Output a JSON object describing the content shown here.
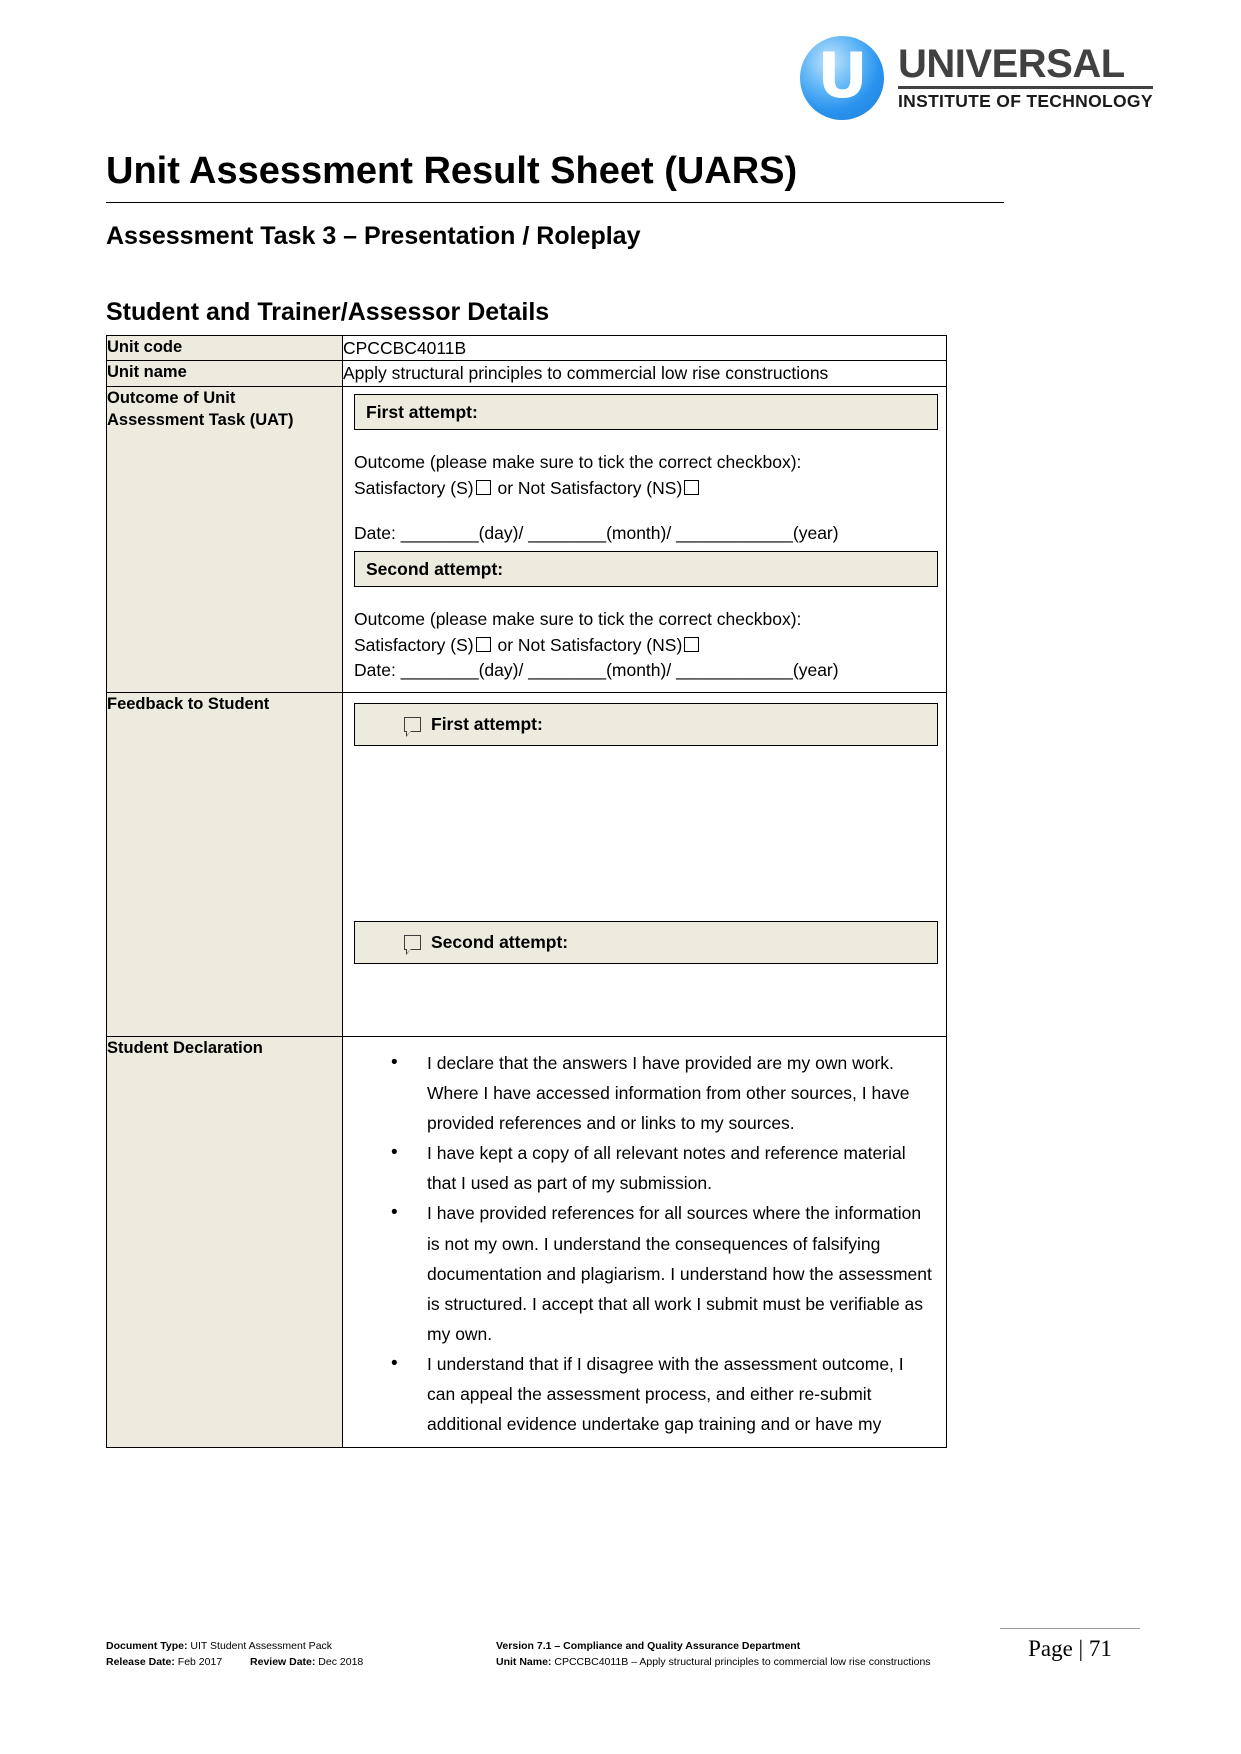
{
  "logo": {
    "mark_letter": "U",
    "title": "UNIVERSAL",
    "subtitle": "INSTITUTE OF TECHNOLOGY",
    "brand_blue": "#2a93ee"
  },
  "header": {
    "doc_title": "Unit Assessment Result Sheet (UARS)",
    "doc_subtitle": "Assessment Task 3 – Presentation / Roleplay",
    "section_title": "Student and Trainer/Assessor Details"
  },
  "table": {
    "unit_code_label": "Unit code",
    "unit_code_value": "CPCCBC4011B",
    "unit_name_label": "Unit name",
    "unit_name_value": "Apply structural principles to commercial low rise constructions",
    "outcome_label_line1": "Outcome of Unit",
    "outcome_label_line2": "Assessment Task (UAT)",
    "first_attempt": "First attempt:",
    "second_attempt": "Second attempt:",
    "outcome_instruction": "Outcome (please make sure to tick the correct checkbox):",
    "satisfactory_prefix": "Satisfactory (S)",
    "satisfactory_mid": "or Not Satisfactory (NS)",
    "date_prefix": "Date:",
    "date_day": "(day)/",
    "date_month": "(month)/",
    "date_year": "(year)",
    "date_blank_short": "________",
    "date_blank_long": "____________",
    "feedback_label": "Feedback to Student",
    "feedback_first": "First attempt:",
    "feedback_second": "Second attempt:",
    "declaration_label": "Student Declaration",
    "declaration_items": [
      "I declare that the answers I have provided are my own work. Where I have accessed information from other sources, I have provided references and or links to my sources.",
      "I have kept a copy of all relevant notes and reference material that I used as part of my submission.",
      "I have provided references for all sources where the information is not my own. I understand the consequences of falsifying documentation and plagiarism. I understand how the assessment is structured. I accept that all work I submit must be verifiable as my own.",
      "I understand that if I disagree with the assessment outcome, I can appeal the assessment process, and either re-submit additional evidence undertake gap training and or have my"
    ]
  },
  "footer": {
    "document_type_label": "Document Type:",
    "document_type_value": "UIT Student Assessment Pack",
    "release_date_label": "Release Date:",
    "release_date_value": "Feb 2017",
    "review_date_label": "Review Date:",
    "review_date_value": "Dec 2018",
    "version_line": "Version 7.1 – Compliance and Quality Assurance Department",
    "unit_name_label": "Unit Name:",
    "unit_name_value": "CPCCBC4011B –  Apply structural principles to commercial low rise constructions",
    "page_label": "Page | 71"
  }
}
